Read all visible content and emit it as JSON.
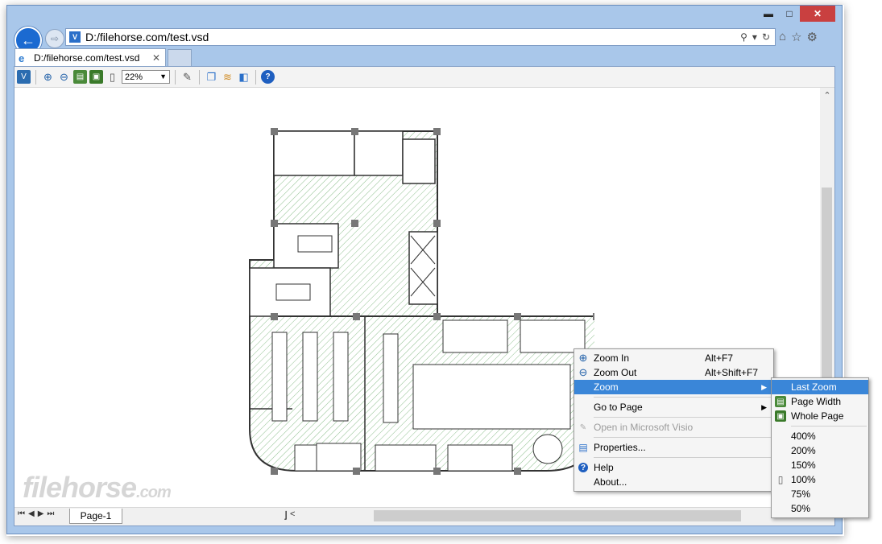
{
  "window": {
    "controls": {
      "minimize": "▬",
      "maximize": "□",
      "close": "✕"
    }
  },
  "address": {
    "url": "D:/filehorse.com/test.vsd",
    "icons": [
      "search-icon",
      "dropdown-icon",
      "refresh-icon"
    ]
  },
  "right_tools": [
    "home-icon",
    "favorites-star-icon",
    "settings-gear-icon"
  ],
  "tab": {
    "title": "D:/filehorse.com/test.vsd",
    "close": "✕"
  },
  "toolbar": {
    "zoom_value": "22%",
    "icons": [
      "visio-viewer-icon",
      "zoom-in-icon",
      "zoom-out-icon",
      "page-width-icon",
      "whole-page-icon",
      "actual-size-icon",
      "properties-icon",
      "copy-icon",
      "layers-icon",
      "pan-icon",
      "help-icon"
    ]
  },
  "bottom": {
    "page_tab": "Page-1",
    "hscroll_left": "<"
  },
  "watermark": {
    "main": "filehorse",
    "suffix": ".com"
  },
  "context_menu": {
    "items": [
      {
        "label": "Zoom In",
        "shortcut": "Alt+F7",
        "icon": "zoom-in-icon"
      },
      {
        "label": "Zoom Out",
        "shortcut": "Alt+Shift+F7",
        "icon": "zoom-out-icon"
      },
      {
        "label": "Zoom",
        "submenu": true
      },
      {
        "label": "Go to Page",
        "submenu": true
      },
      {
        "label": "Open in Microsoft Visio",
        "disabled": true,
        "icon": "visio-icon"
      },
      {
        "label": "Properties...",
        "icon": "properties-icon"
      },
      {
        "label": "Help",
        "icon": "help-icon"
      },
      {
        "label": "About..."
      }
    ]
  },
  "zoom_submenu": {
    "items": [
      {
        "label": "Last Zoom"
      },
      {
        "label": "Page Width",
        "icon": "page-width-icon"
      },
      {
        "label": "Whole Page",
        "icon": "whole-page-icon"
      },
      {
        "label": "400%"
      },
      {
        "label": "200%"
      },
      {
        "label": "150%"
      },
      {
        "label": "100%",
        "icon": "page-icon"
      },
      {
        "label": "75%"
      },
      {
        "label": "50%"
      }
    ]
  },
  "colors": {
    "highlight": "#3a86d8",
    "window_frame": "#a9c7ea",
    "back_button": "#1b6ad1"
  }
}
